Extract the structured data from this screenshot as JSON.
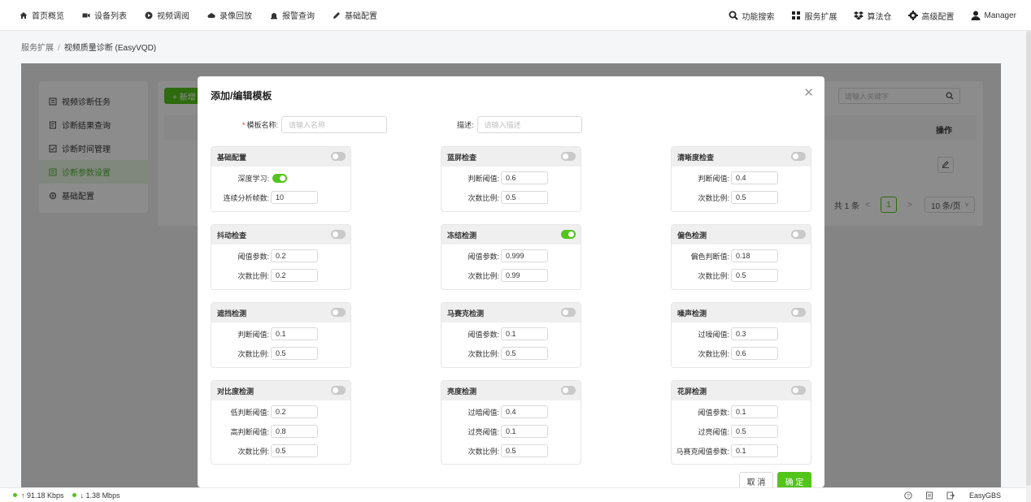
{
  "nav": {
    "left": [
      {
        "label": "首页概览",
        "icon": "home-icon"
      },
      {
        "label": "设备列表",
        "icon": "camera-icon"
      },
      {
        "label": "视频调阅",
        "icon": "play-icon"
      },
      {
        "label": "录像回放",
        "icon": "cloud-icon"
      },
      {
        "label": "报警查询",
        "icon": "alarm-icon"
      },
      {
        "label": "基础配置",
        "icon": "edit-icon"
      }
    ],
    "right": [
      {
        "label": "功能搜索",
        "icon": "search-icon"
      },
      {
        "label": "服务扩展",
        "icon": "grid-icon"
      },
      {
        "label": "算法仓",
        "icon": "dropbox-icon"
      },
      {
        "label": "高级配置",
        "icon": "gear-icon"
      },
      {
        "label": "Manager",
        "icon": "user-icon"
      }
    ]
  },
  "breadcrumb": {
    "parent": "服务扩展",
    "sep": "/",
    "current": "视频质量诊断 (EasyVQD)"
  },
  "sidebar": {
    "items": [
      {
        "label": "视频诊断任务"
      },
      {
        "label": "诊断结果查询"
      },
      {
        "label": "诊断时间管理"
      },
      {
        "label": "诊断参数设置"
      },
      {
        "label": "基础配置"
      }
    ]
  },
  "main": {
    "new_label": "+ 新增",
    "search_placeholder": "请输入关键字",
    "ops_header": "操作",
    "pager": {
      "total": "共 1 条",
      "prev": "<",
      "page": "1",
      "next": ">",
      "size": "10 条/页"
    }
  },
  "modal": {
    "title": "添加/编辑模板",
    "name_label": "模板名称:",
    "name_placeholder": "请输入名称",
    "desc_label": "描述:",
    "desc_placeholder": "请输入描述",
    "cancel": "取 消",
    "ok": "确 定",
    "cards": [
      {
        "title": "基础配置",
        "on": false,
        "rows": [
          {
            "label": "深度学习:",
            "value": "",
            "toggle": true
          },
          {
            "label": "连续分析帧数:",
            "value": "10"
          }
        ]
      },
      {
        "title": "蓝屏检查",
        "on": false,
        "rows": [
          {
            "label": "判断阈值:",
            "value": "0.6"
          },
          {
            "label": "次数比例:",
            "value": "0.5"
          }
        ]
      },
      {
        "title": "清晰度检查",
        "on": false,
        "rows": [
          {
            "label": "判断阈值:",
            "value": "0.4"
          },
          {
            "label": "次数比例:",
            "value": "0.5"
          }
        ]
      },
      {
        "title": "抖动检查",
        "on": false,
        "rows": [
          {
            "label": "阈值参数:",
            "value": "0.2"
          },
          {
            "label": "次数比例:",
            "value": "0.2"
          }
        ]
      },
      {
        "title": "冻结检测",
        "on": true,
        "rows": [
          {
            "label": "阈值参数:",
            "value": "0.999"
          },
          {
            "label": "次数比例:",
            "value": "0.99"
          }
        ]
      },
      {
        "title": "偏色检测",
        "on": false,
        "rows": [
          {
            "label": "偏色判断值:",
            "value": "0.18"
          },
          {
            "label": "次数比例:",
            "value": "0.5"
          }
        ]
      },
      {
        "title": "遮挡检测",
        "on": false,
        "rows": [
          {
            "label": "判断阈值:",
            "value": "0.1"
          },
          {
            "label": "次数比例:",
            "value": "0.5"
          }
        ]
      },
      {
        "title": "马赛克检测",
        "on": false,
        "rows": [
          {
            "label": "阈值参数:",
            "value": "0.1"
          },
          {
            "label": "次数比例:",
            "value": "0.5"
          }
        ]
      },
      {
        "title": "噪声检测",
        "on": false,
        "rows": [
          {
            "label": "过噪阈值:",
            "value": "0.3"
          },
          {
            "label": "次数比例:",
            "value": "0.6"
          }
        ]
      },
      {
        "title": "对比度检测",
        "on": false,
        "rows": [
          {
            "label": "低判断阈值:",
            "value": "0.2"
          },
          {
            "label": "高判断阈值:",
            "value": "0.8"
          },
          {
            "label": "次数比例:",
            "value": "0.5"
          }
        ]
      },
      {
        "title": "亮度检测",
        "on": false,
        "rows": [
          {
            "label": "过暗阈值:",
            "value": "0.4"
          },
          {
            "label": "过亮阈值:",
            "value": "0.1"
          },
          {
            "label": "次数比例:",
            "value": "0.5"
          }
        ]
      },
      {
        "title": "花屏检测",
        "on": false,
        "rows": [
          {
            "label": "阈值参数:",
            "value": "0.1"
          },
          {
            "label": "过亮阈值:",
            "value": "0.5"
          },
          {
            "label": "马赛克阈值参数:",
            "value": "0.1"
          }
        ]
      }
    ]
  },
  "footer": {
    "up": "↑ 91.18 Kbps",
    "down": "↓ 1.38 Mbps",
    "brand": "EasyGBS"
  },
  "colors": {
    "accent": "#52c41a",
    "active_bg": "#eaf6e4"
  }
}
